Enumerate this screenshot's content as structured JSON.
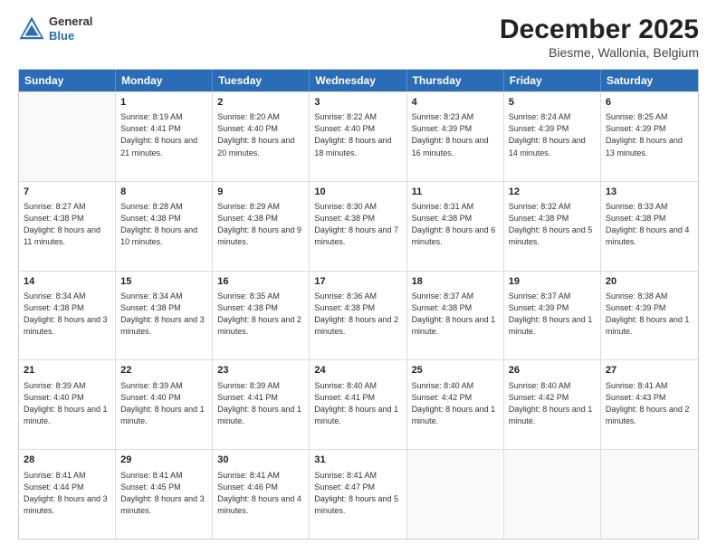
{
  "header": {
    "logo": {
      "general": "General",
      "blue": "Blue"
    },
    "title": "December 2025",
    "subtitle": "Biesme, Wallonia, Belgium"
  },
  "calendar": {
    "days_of_week": [
      "Sunday",
      "Monday",
      "Tuesday",
      "Wednesday",
      "Thursday",
      "Friday",
      "Saturday"
    ],
    "rows": [
      [
        {
          "day": "",
          "sunrise": "",
          "sunset": "",
          "daylight": ""
        },
        {
          "day": "1",
          "sunrise": "Sunrise: 8:19 AM",
          "sunset": "Sunset: 4:41 PM",
          "daylight": "Daylight: 8 hours and 21 minutes."
        },
        {
          "day": "2",
          "sunrise": "Sunrise: 8:20 AM",
          "sunset": "Sunset: 4:40 PM",
          "daylight": "Daylight: 8 hours and 20 minutes."
        },
        {
          "day": "3",
          "sunrise": "Sunrise: 8:22 AM",
          "sunset": "Sunset: 4:40 PM",
          "daylight": "Daylight: 8 hours and 18 minutes."
        },
        {
          "day": "4",
          "sunrise": "Sunrise: 8:23 AM",
          "sunset": "Sunset: 4:39 PM",
          "daylight": "Daylight: 8 hours and 16 minutes."
        },
        {
          "day": "5",
          "sunrise": "Sunrise: 8:24 AM",
          "sunset": "Sunset: 4:39 PM",
          "daylight": "Daylight: 8 hours and 14 minutes."
        },
        {
          "day": "6",
          "sunrise": "Sunrise: 8:25 AM",
          "sunset": "Sunset: 4:39 PM",
          "daylight": "Daylight: 8 hours and 13 minutes."
        }
      ],
      [
        {
          "day": "7",
          "sunrise": "Sunrise: 8:27 AM",
          "sunset": "Sunset: 4:38 PM",
          "daylight": "Daylight: 8 hours and 11 minutes."
        },
        {
          "day": "8",
          "sunrise": "Sunrise: 8:28 AM",
          "sunset": "Sunset: 4:38 PM",
          "daylight": "Daylight: 8 hours and 10 minutes."
        },
        {
          "day": "9",
          "sunrise": "Sunrise: 8:29 AM",
          "sunset": "Sunset: 4:38 PM",
          "daylight": "Daylight: 8 hours and 9 minutes."
        },
        {
          "day": "10",
          "sunrise": "Sunrise: 8:30 AM",
          "sunset": "Sunset: 4:38 PM",
          "daylight": "Daylight: 8 hours and 7 minutes."
        },
        {
          "day": "11",
          "sunrise": "Sunrise: 8:31 AM",
          "sunset": "Sunset: 4:38 PM",
          "daylight": "Daylight: 8 hours and 6 minutes."
        },
        {
          "day": "12",
          "sunrise": "Sunrise: 8:32 AM",
          "sunset": "Sunset: 4:38 PM",
          "daylight": "Daylight: 8 hours and 5 minutes."
        },
        {
          "day": "13",
          "sunrise": "Sunrise: 8:33 AM",
          "sunset": "Sunset: 4:38 PM",
          "daylight": "Daylight: 8 hours and 4 minutes."
        }
      ],
      [
        {
          "day": "14",
          "sunrise": "Sunrise: 8:34 AM",
          "sunset": "Sunset: 4:38 PM",
          "daylight": "Daylight: 8 hours and 3 minutes."
        },
        {
          "day": "15",
          "sunrise": "Sunrise: 8:34 AM",
          "sunset": "Sunset: 4:38 PM",
          "daylight": "Daylight: 8 hours and 3 minutes."
        },
        {
          "day": "16",
          "sunrise": "Sunrise: 8:35 AM",
          "sunset": "Sunset: 4:38 PM",
          "daylight": "Daylight: 8 hours and 2 minutes."
        },
        {
          "day": "17",
          "sunrise": "Sunrise: 8:36 AM",
          "sunset": "Sunset: 4:38 PM",
          "daylight": "Daylight: 8 hours and 2 minutes."
        },
        {
          "day": "18",
          "sunrise": "Sunrise: 8:37 AM",
          "sunset": "Sunset: 4:38 PM",
          "daylight": "Daylight: 8 hours and 1 minute."
        },
        {
          "day": "19",
          "sunrise": "Sunrise: 8:37 AM",
          "sunset": "Sunset: 4:39 PM",
          "daylight": "Daylight: 8 hours and 1 minute."
        },
        {
          "day": "20",
          "sunrise": "Sunrise: 8:38 AM",
          "sunset": "Sunset: 4:39 PM",
          "daylight": "Daylight: 8 hours and 1 minute."
        }
      ],
      [
        {
          "day": "21",
          "sunrise": "Sunrise: 8:39 AM",
          "sunset": "Sunset: 4:40 PM",
          "daylight": "Daylight: 8 hours and 1 minute."
        },
        {
          "day": "22",
          "sunrise": "Sunrise: 8:39 AM",
          "sunset": "Sunset: 4:40 PM",
          "daylight": "Daylight: 8 hours and 1 minute."
        },
        {
          "day": "23",
          "sunrise": "Sunrise: 8:39 AM",
          "sunset": "Sunset: 4:41 PM",
          "daylight": "Daylight: 8 hours and 1 minute."
        },
        {
          "day": "24",
          "sunrise": "Sunrise: 8:40 AM",
          "sunset": "Sunset: 4:41 PM",
          "daylight": "Daylight: 8 hours and 1 minute."
        },
        {
          "day": "25",
          "sunrise": "Sunrise: 8:40 AM",
          "sunset": "Sunset: 4:42 PM",
          "daylight": "Daylight: 8 hours and 1 minute."
        },
        {
          "day": "26",
          "sunrise": "Sunrise: 8:40 AM",
          "sunset": "Sunset: 4:42 PM",
          "daylight": "Daylight: 8 hours and 1 minute."
        },
        {
          "day": "27",
          "sunrise": "Sunrise: 8:41 AM",
          "sunset": "Sunset: 4:43 PM",
          "daylight": "Daylight: 8 hours and 2 minutes."
        }
      ],
      [
        {
          "day": "28",
          "sunrise": "Sunrise: 8:41 AM",
          "sunset": "Sunset: 4:44 PM",
          "daylight": "Daylight: 8 hours and 3 minutes."
        },
        {
          "day": "29",
          "sunrise": "Sunrise: 8:41 AM",
          "sunset": "Sunset: 4:45 PM",
          "daylight": "Daylight: 8 hours and 3 minutes."
        },
        {
          "day": "30",
          "sunrise": "Sunrise: 8:41 AM",
          "sunset": "Sunset: 4:46 PM",
          "daylight": "Daylight: 8 hours and 4 minutes."
        },
        {
          "day": "31",
          "sunrise": "Sunrise: 8:41 AM",
          "sunset": "Sunset: 4:47 PM",
          "daylight": "Daylight: 8 hours and 5 minutes."
        },
        {
          "day": "",
          "sunrise": "",
          "sunset": "",
          "daylight": ""
        },
        {
          "day": "",
          "sunrise": "",
          "sunset": "",
          "daylight": ""
        },
        {
          "day": "",
          "sunrise": "",
          "sunset": "",
          "daylight": ""
        }
      ]
    ]
  }
}
